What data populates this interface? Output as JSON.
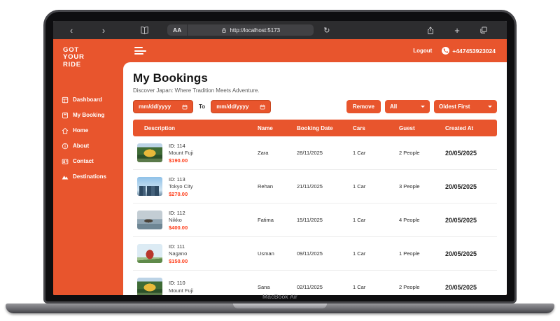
{
  "device": {
    "label": "MacBook Air"
  },
  "browser": {
    "text_size_label": "AA",
    "url": "http://localhost:5173",
    "reload_glyph": "↻",
    "back_glyph": "‹",
    "forward_glyph": "›",
    "plus_glyph": "+"
  },
  "app": {
    "logo_lines": {
      "l1": "GOT",
      "l2": "YOUR",
      "l3": "RIDE"
    },
    "topbar": {
      "logout_label": "Logout",
      "phone": "+447453923024"
    },
    "sidebar": {
      "items": [
        {
          "label": "Dashboard"
        },
        {
          "label": "My Booking"
        },
        {
          "label": "Home"
        },
        {
          "label": "About"
        },
        {
          "label": "Contact"
        },
        {
          "label": "Destinations"
        }
      ]
    },
    "page": {
      "title": "My Bookings",
      "subtitle": "Discover Japan: Where Tradition Meets Adventure.",
      "filters": {
        "date_from_value": "mm/dd/yyyy",
        "date_to_value": "mm/dd/yyyy",
        "to_label": "To",
        "remove_label": "Remove",
        "category_selected": "All",
        "sort_selected": "Oldest First"
      },
      "table": {
        "headers": [
          "Description",
          "Name",
          "Booking Date",
          "Cars",
          "Guest",
          "Created At"
        ],
        "rows": [
          {
            "id": "ID: 114",
            "destination": "Mount Fuji",
            "price": "$190.00",
            "name": "Zara",
            "booking_date": "28/11/2025",
            "cars": "1 Car",
            "guest": "2 People",
            "created_at": "20/05/2025",
            "thumb": "pavilion"
          },
          {
            "id": "ID: 113",
            "destination": "Tokyo City",
            "price": "$270.00",
            "name": "Rehan",
            "booking_date": "21/11/2025",
            "cars": "1 Car",
            "guest": "3 People",
            "created_at": "20/05/2025",
            "thumb": "city"
          },
          {
            "id": "ID: 112",
            "destination": "Nikko",
            "price": "$400.00",
            "name": "Fatima",
            "booking_date": "15/11/2025",
            "cars": "1 Car",
            "guest": "4 People",
            "created_at": "20/05/2025",
            "thumb": "lake"
          },
          {
            "id": "ID: 111",
            "destination": "Nagano",
            "price": "$150.00",
            "name": "Usman",
            "booking_date": "09/11/2025",
            "cars": "1 Car",
            "guest": "1 People",
            "created_at": "20/05/2025",
            "thumb": "pagoda"
          },
          {
            "id": "ID: 110",
            "destination": "Mount Fuji",
            "price": "",
            "name": "Sana",
            "booking_date": "02/11/2025",
            "cars": "1 Car",
            "guest": "2 People",
            "created_at": "20/05/2025",
            "thumb": "pavilion"
          }
        ]
      }
    }
  },
  "colors": {
    "accent": "#E8552D",
    "price": "#FF3B17",
    "chrome": "#2D2D2F"
  }
}
